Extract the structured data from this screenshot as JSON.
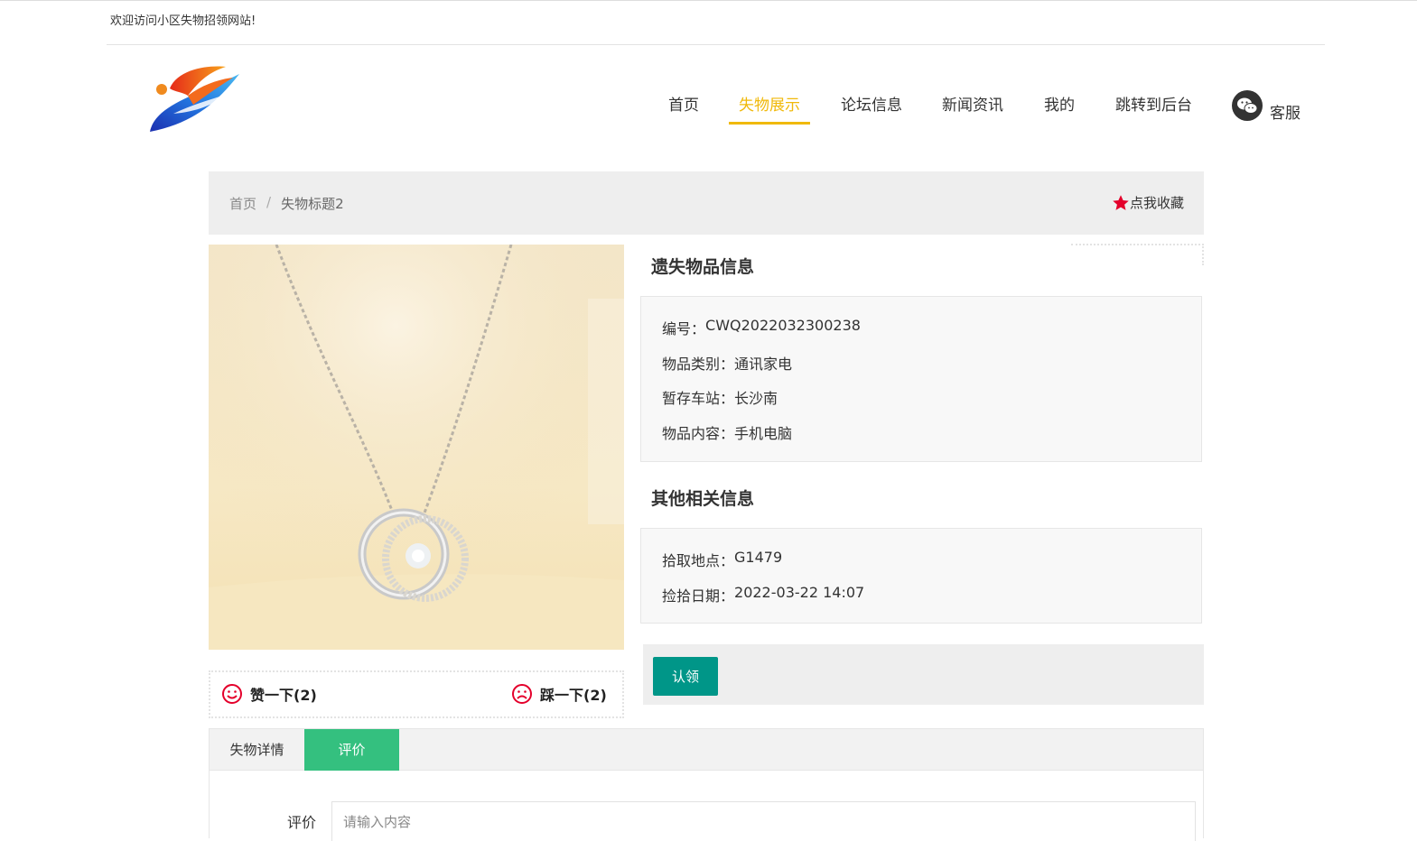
{
  "header": {
    "welcome": "欢迎访问小区失物招领网站!"
  },
  "nav": {
    "items": [
      {
        "label": "首页"
      },
      {
        "label": "失物展示",
        "active": true
      },
      {
        "label": "论坛信息"
      },
      {
        "label": "新闻资讯"
      },
      {
        "label": "我的"
      },
      {
        "label": "跳转到后台"
      }
    ],
    "service_label": "客服"
  },
  "breadcrumb": {
    "home": "首页",
    "separator": "/",
    "current": "失物标题2"
  },
  "favorite_label": "点我收藏",
  "thumbs": {
    "up_label": "赞一下(2)",
    "down_label": "踩一下(2)"
  },
  "lost_info": {
    "title": "遗失物品信息",
    "rows": [
      {
        "key": "编号：",
        "value": "CWQ2022032300238"
      },
      {
        "key": "物品类别：",
        "value": "通讯家电"
      },
      {
        "key": "暂存车站：",
        "value": "长沙南"
      },
      {
        "key": "物品内容：",
        "value": "手机电脑"
      }
    ]
  },
  "other_info": {
    "title": "其他相关信息",
    "rows": [
      {
        "key": "拾取地点：",
        "value": "G1479"
      },
      {
        "key": "捡拾日期：",
        "value": "2022-03-22 14:07"
      }
    ]
  },
  "claim_label": "认领",
  "tabs": [
    {
      "label": "失物详情"
    },
    {
      "label": "评价",
      "active": true
    }
  ],
  "comment": {
    "label": "评价",
    "placeholder": "请输入内容"
  },
  "colors": {
    "nav_active": "#f0b90b",
    "claim_button": "#009688",
    "tab_active": "#34c07f",
    "star": "#e4002b"
  }
}
